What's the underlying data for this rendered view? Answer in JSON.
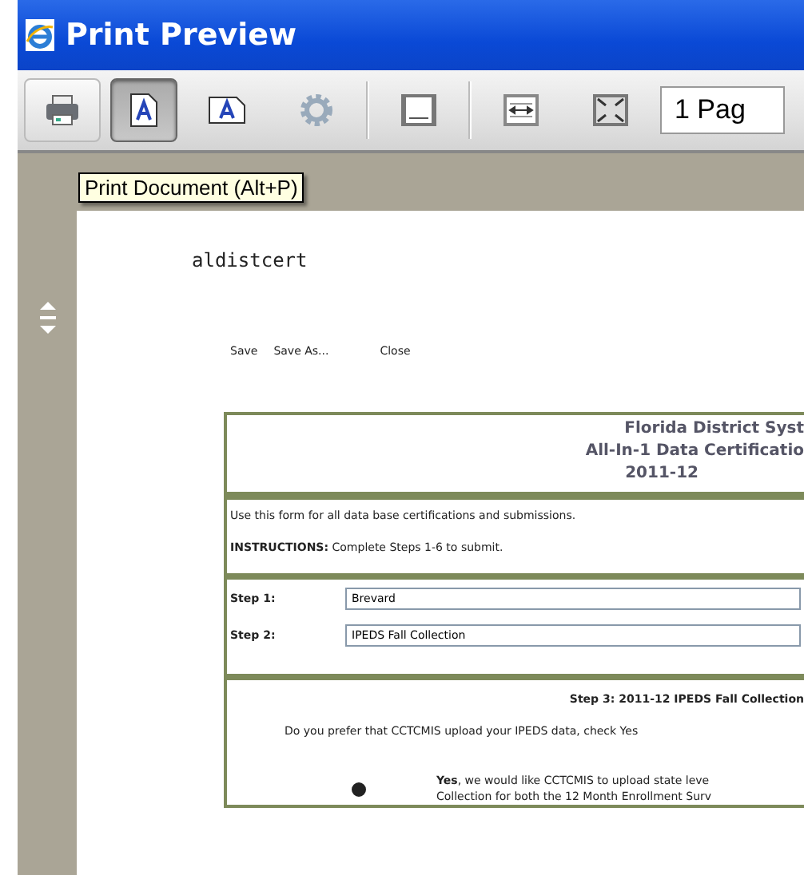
{
  "window": {
    "title": "Print Preview"
  },
  "toolbar": {
    "buttons": [
      {
        "kind": "print",
        "selected": false
      },
      {
        "kind": "portrait",
        "selected": true
      },
      {
        "kind": "landscape",
        "selected": false
      },
      {
        "kind": "settings",
        "selected": false
      },
      {
        "kind": "header",
        "selected": false
      },
      {
        "kind": "fit-width",
        "selected": false
      },
      {
        "kind": "full-page",
        "selected": false
      }
    ],
    "page_view": "1 Pag"
  },
  "tooltip": "Print Document (Alt+P)",
  "document": {
    "name": "aldistcert",
    "links": [
      "Save",
      "Save As...",
      "Close"
    ],
    "header": [
      "Florida District Syst",
      "All-In-1 Data Certificatio",
      "2011-12"
    ],
    "intro": "Use this form for all data base certifications and submissions.",
    "instructions": "**INSTRUCTIONS:**  Complete Steps 1-6 to submit.",
    "steps": [
      {
        "label": "Step 1:",
        "value": "Brevard"
      },
      {
        "label": "Step 2:",
        "value": "IPEDS Fall Collection"
      }
    ],
    "step3_title": "Step 3:     2011-12 IPEDS Fall Collection",
    "question": "Do you prefer that CCTCMIS upload your IPEDS data, check Yes",
    "option": {
      "selected": true,
      "lines": [
        "**Yes**, we would like CCTCMIS to upload state leve",
        "Collection for both the 12 Month Enrollment Surv"
      ]
    }
  }
}
